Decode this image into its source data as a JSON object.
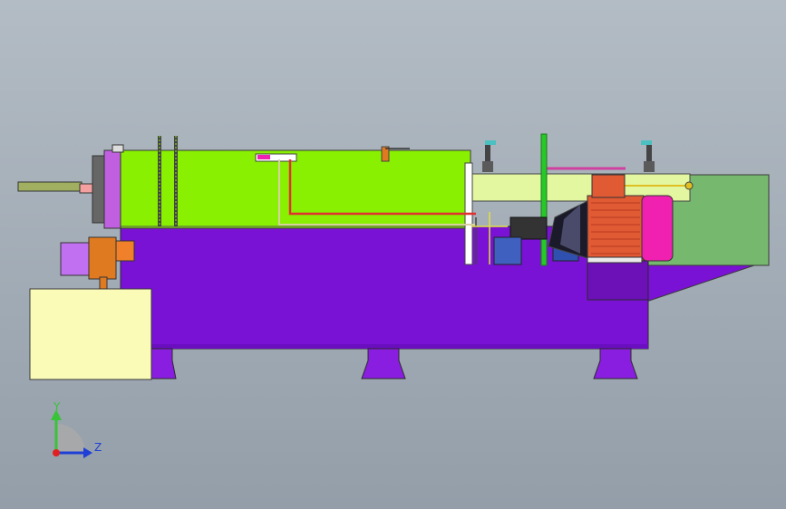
{
  "triad": {
    "y_label": "Y",
    "z_label": "Z",
    "y_color": "#39c339",
    "z_color": "#1f3fd6",
    "origin_color": "#e02020"
  },
  "colors": {
    "background_top": "#b3bcc4",
    "background_bottom": "#949ea9",
    "bowl_housing": "#88f000",
    "frame_base": "#7a12d6",
    "motor_body": "#e05a34",
    "motor_fan_cover": "#f020b0",
    "drive_tube": "#e3f7a0",
    "cabinet": "#fbfbb8",
    "belt_guard": "#76b86e"
  },
  "icons": [
    "y-axis-arrow-icon",
    "z-axis-arrow-icon",
    "origin-point-icon"
  ]
}
